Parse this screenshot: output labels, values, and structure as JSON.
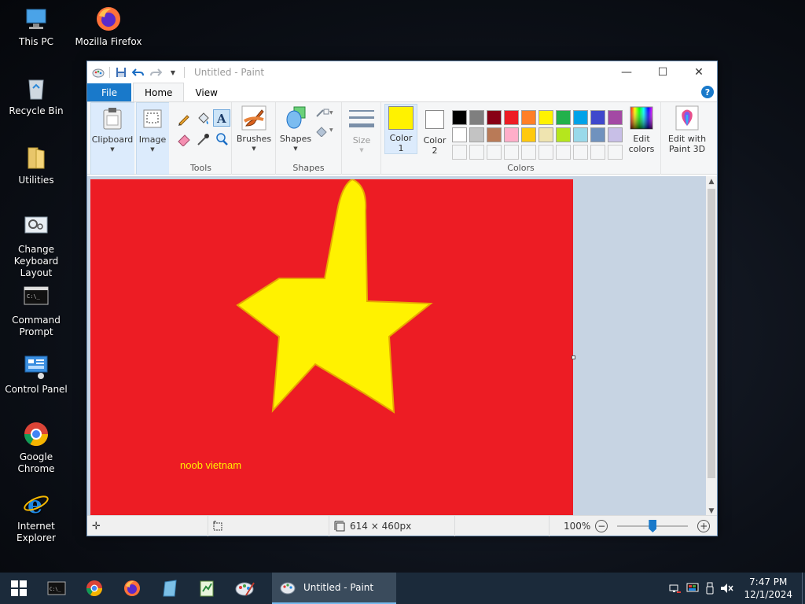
{
  "desktop": {
    "icons": [
      {
        "label": "This PC"
      },
      {
        "label": "Mozilla Firefox"
      },
      {
        "label": "Recycle Bin"
      },
      {
        "label": "Utilities"
      },
      {
        "label": "Change Keyboard Layout"
      },
      {
        "label": "Command Prompt"
      },
      {
        "label": "Control Panel"
      },
      {
        "label": "Google Chrome"
      },
      {
        "label": "Internet Explorer"
      }
    ]
  },
  "window": {
    "title": "Untitled - Paint",
    "controls": {
      "minimize": "—",
      "maximize": "☐",
      "close": "✕"
    },
    "tabs": {
      "file": "File",
      "home": "Home",
      "view": "View"
    },
    "help": "?"
  },
  "ribbon": {
    "clipboard": "Clipboard",
    "image": "Image",
    "tools": "Tools",
    "brushes": "Brushes",
    "shapes_btn": "Shapes",
    "shapes_group": "Shapes",
    "size": "Size",
    "color1_a": "Color",
    "color1_b": "1",
    "color2_a": "Color",
    "color2_b": "2",
    "edit_colors_a": "Edit",
    "edit_colors_b": "colors",
    "edit_3d_a": "Edit with",
    "edit_3d_b": "Paint 3D",
    "colors_group": "Colors",
    "color1_value": "#fff200",
    "color2_value": "#ffffff",
    "palette_row1": [
      "#000000",
      "#7f7f7f",
      "#880015",
      "#ed1c24",
      "#ff7f27",
      "#fff200",
      "#22b14c",
      "#00a2e8",
      "#3f48cc",
      "#a349a4"
    ],
    "palette_row2": [
      "#ffffff",
      "#c3c3c3",
      "#b97a57",
      "#ffaec9",
      "#ffc90e",
      "#efe4b0",
      "#b5e61d",
      "#99d9ea",
      "#7092be",
      "#c8bfe7"
    ]
  },
  "canvas": {
    "background": "#ed1c24",
    "star_color": "#fff200",
    "text": "noob vietnam"
  },
  "status": {
    "size": "614 × 460px",
    "zoom": "100%",
    "zoom_out": "−",
    "zoom_in": "+"
  },
  "taskbar": {
    "active_task": "Untitled - Paint",
    "time": "7:47 PM",
    "date": "12/1/2024"
  }
}
